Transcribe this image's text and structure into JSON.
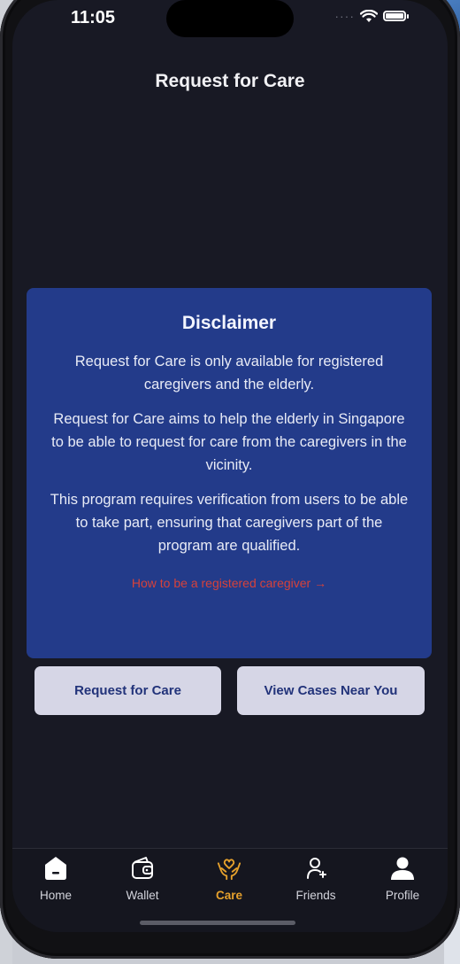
{
  "status_bar": {
    "time": "11:05"
  },
  "header": {
    "title": "Request for Care"
  },
  "disclaimer": {
    "title": "Disclaimer",
    "paragraphs": [
      "Request for Care is only available for registered caregivers and the elderly.",
      "Request for Care aims to help the elderly in Singapore to be able to request for care from the caregivers in the vicinity.",
      "This program requires verification from users to be able to take part, ensuring that caregivers part of the program are qualified."
    ],
    "link": "How to be a registered caregiver →"
  },
  "actions": {
    "request_label": "Request for Care",
    "view_cases_label": "View Cases Near You"
  },
  "tabbar": {
    "items": [
      {
        "label": "Home",
        "icon": "home-icon"
      },
      {
        "label": "Wallet",
        "icon": "wallet-icon"
      },
      {
        "label": "Care",
        "icon": "care-hands-heart-icon",
        "active": true
      },
      {
        "label": "Friends",
        "icon": "add-friend-icon"
      },
      {
        "label": "Profile",
        "icon": "profile-icon"
      }
    ]
  },
  "colors": {
    "background": "#181924",
    "card": "#233b8a",
    "button": "#d6d6e6",
    "button_text": "#22337a",
    "accent": "#e6a12c",
    "link": "#d6423b"
  }
}
